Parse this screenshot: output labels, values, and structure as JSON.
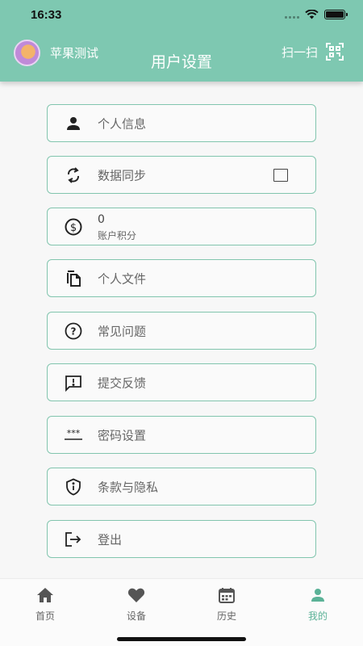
{
  "status_bar": {
    "time": "16:33"
  },
  "header": {
    "username": "苹果测试",
    "title": "用户设置",
    "scan_label": "扫一扫",
    "avatar_icon": "avatar-icon",
    "scan_icon": "qr-scan-icon",
    "background": "#7ec8b1"
  },
  "menu": {
    "profile": {
      "label": "个人信息",
      "icon": "person-icon"
    },
    "sync": {
      "label": "数据同步",
      "icon": "sync-icon",
      "checked": false
    },
    "points": {
      "value": "0",
      "label": "账户积分",
      "icon": "dollar-coin-icon"
    },
    "files": {
      "label": "个人文件",
      "icon": "file-copy-icon"
    },
    "faq": {
      "label": "常见问题",
      "icon": "help-icon"
    },
    "feedback": {
      "label": "提交反馈",
      "icon": "feedback-icon"
    },
    "password": {
      "label": "密码设置",
      "icon": "password-icon"
    },
    "terms": {
      "label": "条款与隐私",
      "icon": "shield-info-icon"
    },
    "logout": {
      "label": "登出",
      "icon": "logout-icon"
    }
  },
  "tabbar": {
    "tabs": [
      {
        "label": "首页",
        "icon": "home-icon"
      },
      {
        "label": "设备",
        "icon": "heart-icon"
      },
      {
        "label": "历史",
        "icon": "calendar-icon"
      },
      {
        "label": "我的",
        "icon": "person-icon"
      }
    ],
    "active_index": 3,
    "active_color": "#5bb297"
  },
  "colors": {
    "accent": "#7ec8b1",
    "border": "#82c5ae"
  }
}
